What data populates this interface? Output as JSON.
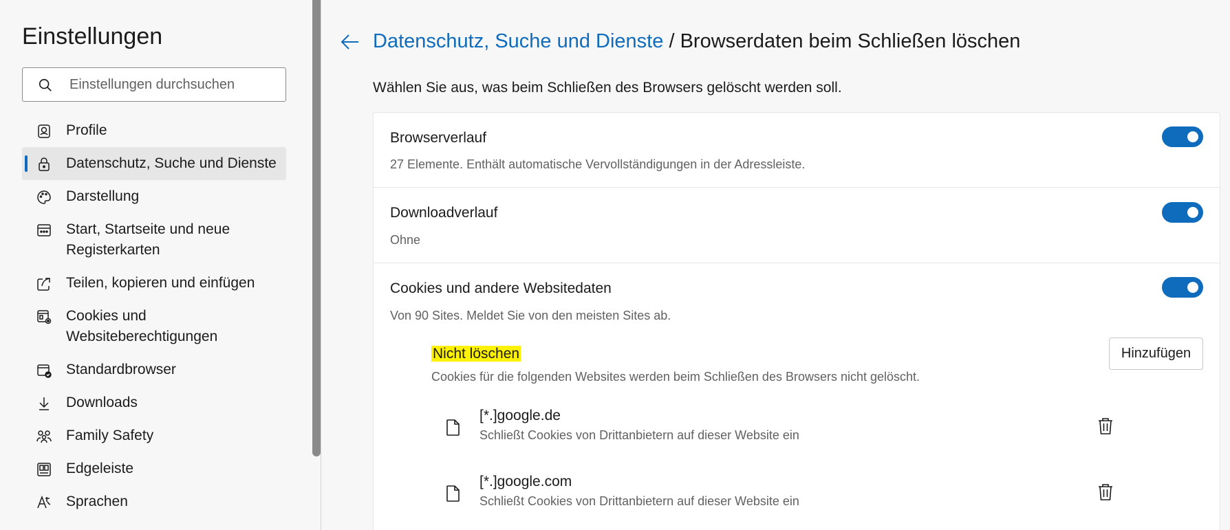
{
  "sidebar": {
    "title": "Einstellungen",
    "search_placeholder": "Einstellungen durchsuchen",
    "items": [
      {
        "label": "Profile",
        "icon": "profile-icon"
      },
      {
        "label": "Datenschutz, Suche und Dienste",
        "icon": "lock-icon",
        "active": true
      },
      {
        "label": "Darstellung",
        "icon": "palette-icon"
      },
      {
        "label": "Start, Startseite und neue Registerkarten",
        "icon": "start-page-icon"
      },
      {
        "label": "Teilen, kopieren und einfügen",
        "icon": "share-icon"
      },
      {
        "label": "Cookies und Websiteberechtigungen",
        "icon": "cookies-permissions-icon"
      },
      {
        "label": "Standardbrowser",
        "icon": "default-browser-icon"
      },
      {
        "label": "Downloads",
        "icon": "download-icon"
      },
      {
        "label": "Family Safety",
        "icon": "family-icon"
      },
      {
        "label": "Edgeleiste",
        "icon": "sidebar-panel-icon"
      },
      {
        "label": "Sprachen",
        "icon": "languages-icon"
      }
    ]
  },
  "header": {
    "breadcrumb_link": "Datenschutz, Suche und Dienste",
    "separator": "/",
    "current": "Browserdaten beim Schließen löschen"
  },
  "description": "Wählen Sie aus, was beim Schließen des Browsers gelöscht werden soll.",
  "settings": [
    {
      "title": "Browserverlauf",
      "subtitle": "27 Elemente. Enthält automatische Vervollständigungen in der Adressleiste.",
      "enabled": true
    },
    {
      "title": "Downloadverlauf",
      "subtitle": "Ohne",
      "enabled": true
    },
    {
      "title": "Cookies und andere Websitedaten",
      "subtitle": "Von 90 Sites. Meldet Sie von den meisten Sites ab.",
      "enabled": true
    }
  ],
  "exceptions": {
    "title": "Nicht löschen",
    "description": "Cookies für die folgenden Websites werden beim Schließen des Browsers nicht gelöscht.",
    "add_label": "Hinzufügen",
    "sites": [
      {
        "name": "[*.]google.de",
        "detail": "Schließt Cookies von Drittanbietern auf dieser Website ein"
      },
      {
        "name": "[*.]google.com",
        "detail": "Schließt Cookies von Drittanbietern auf dieser Website ein"
      }
    ]
  },
  "colors": {
    "accent": "#0f6cbd",
    "highlight": "#fff200"
  }
}
